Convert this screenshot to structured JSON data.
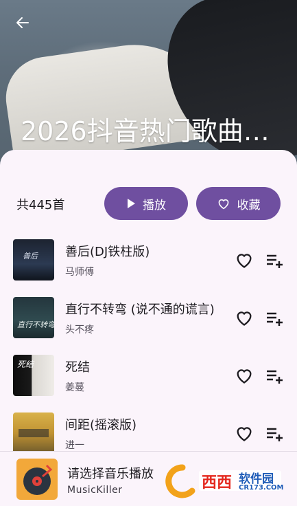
{
  "header": {
    "title": "2026抖音热门歌曲合..."
  },
  "summary": {
    "count_label": "共445首"
  },
  "actions": {
    "play_label": "播放",
    "favorite_label": "收藏"
  },
  "songs": [
    {
      "title": "善后(DJ铁柱版)",
      "artist": "马师傅"
    },
    {
      "title": "直行不转弯 (说不通的谎言)",
      "artist": "头不疼"
    },
    {
      "title": "死结",
      "artist": "姜蔓"
    },
    {
      "title": "间距(摇滚版)",
      "artist": "进一"
    }
  ],
  "player": {
    "title": "请选择音乐播放",
    "subtitle": "MusicKiller"
  },
  "watermark": {
    "brand": "西西",
    "sub": "软件园",
    "url": "CR173.COM"
  },
  "colors": {
    "accent": "#6f4fa0",
    "panel": "#fbf4fb"
  }
}
